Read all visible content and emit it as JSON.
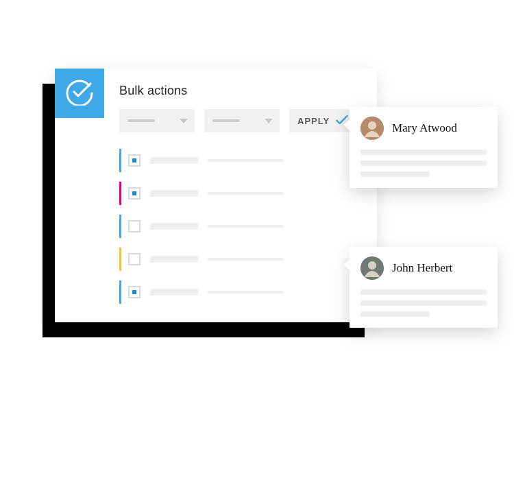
{
  "header": {
    "title": "Bulk actions"
  },
  "controls": {
    "apply_label": "APPLY"
  },
  "rows": [
    {
      "accent": "#3ea9e6",
      "selected": true
    },
    {
      "accent": "#e6007e",
      "selected": true
    },
    {
      "accent": "#3ea9e6",
      "selected": false
    },
    {
      "accent": "#f4c430",
      "selected": false
    },
    {
      "accent": "#3ea9e6",
      "selected": true
    }
  ],
  "cards": [
    {
      "name": "Mary Atwood"
    },
    {
      "name": "John Herbert"
    }
  ],
  "colors": {
    "brand": "#3ea9e6"
  }
}
